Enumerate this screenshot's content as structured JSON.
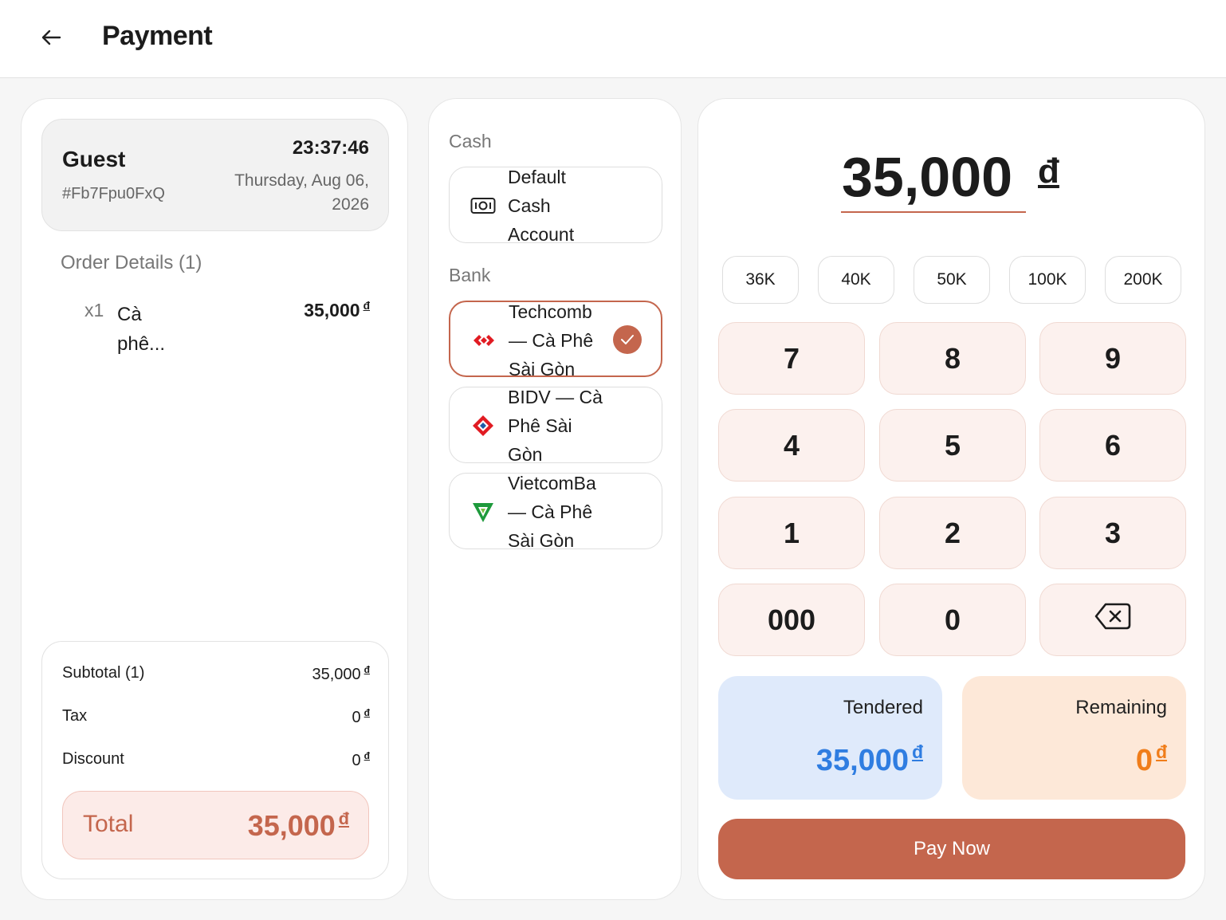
{
  "header": {
    "title": "Payment",
    "back_icon": "arrow-left-icon"
  },
  "guest": {
    "name": "Guest",
    "order_id": "#Fb7Fpu0FxQ",
    "time": "23:37:46",
    "date": "Thursday, Aug 06, 2026"
  },
  "order": {
    "heading": "Order Details (1)",
    "items": [
      {
        "qty": "x1",
        "name": "Cà phê...",
        "price": "35,000"
      }
    ]
  },
  "summary": {
    "subtotal_label": "Subtotal (1)",
    "subtotal_value": "35,000",
    "tax_label": "Tax",
    "tax_value": "0",
    "discount_label": "Discount",
    "discount_value": "0",
    "total_label": "Total",
    "total_value": "35,000"
  },
  "currency_symbol": "đ",
  "methods": {
    "cash_label": "Cash",
    "bank_label": "Bank",
    "cash": [
      {
        "name": "Default Cash Account",
        "icon": "cash-icon"
      }
    ],
    "banks": [
      {
        "name": "Techcomb — Cà Phê Sài Gòn",
        "icon": "techcombank-logo-icon",
        "selected": true
      },
      {
        "name": "BIDV — Cà Phê Sài Gòn",
        "icon": "bidv-logo-icon",
        "selected": false
      },
      {
        "name": "VietcomBa — Cà Phê Sài Gòn",
        "icon": "vietcombank-logo-icon",
        "selected": false
      }
    ]
  },
  "amount": {
    "value": "35,000",
    "currency": "đ"
  },
  "quick_amounts": [
    "36K",
    "40K",
    "50K",
    "100K",
    "200K"
  ],
  "keypad": [
    "7",
    "8",
    "9",
    "4",
    "5",
    "6",
    "1",
    "2",
    "3",
    "000",
    "0"
  ],
  "keypad_backspace_icon": "backspace-icon",
  "tendered": {
    "label": "Tendered",
    "value": "35,000"
  },
  "remaining": {
    "label": "Remaining",
    "value": "0"
  },
  "pay_button": "Pay Now",
  "colors": {
    "accent": "#c4664d",
    "tendered_text": "#2f7de1",
    "remaining_text": "#f07d1a",
    "tendered_bg": "#dfeafb",
    "remaining_bg": "#fde8d8"
  }
}
